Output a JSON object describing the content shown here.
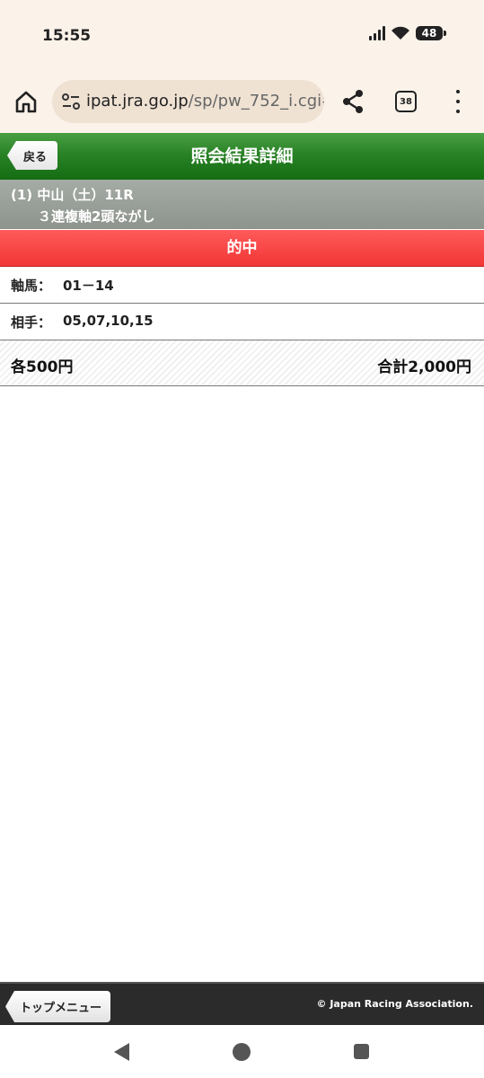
{
  "status_bar": {
    "time": "15:55",
    "battery": "48"
  },
  "browser": {
    "url_host": "ipat.jra.go.jp",
    "url_path": "/sp/pw_752_i.cgi#",
    "tab_count": "38"
  },
  "header": {
    "back_label": "戻る",
    "title": "照会結果詳細"
  },
  "race": {
    "line1": "(1) 中山（土）11R",
    "line2": "３連複軸2頭ながし"
  },
  "result": {
    "hit_label": "的中"
  },
  "bet": {
    "axis_label": "軸馬：",
    "axis_value": "01－14",
    "partner_label": "相手：",
    "partner_value": "05,07,10,15",
    "each_amount": "各500円",
    "total_amount": "合計2,000円"
  },
  "footer": {
    "top_menu_label": "トップメニュー",
    "copyright": "© Japan Racing Association."
  },
  "colors": {
    "header_green": "#146d12",
    "hit_red": "#f23636",
    "race_gray": "#8d938d"
  }
}
